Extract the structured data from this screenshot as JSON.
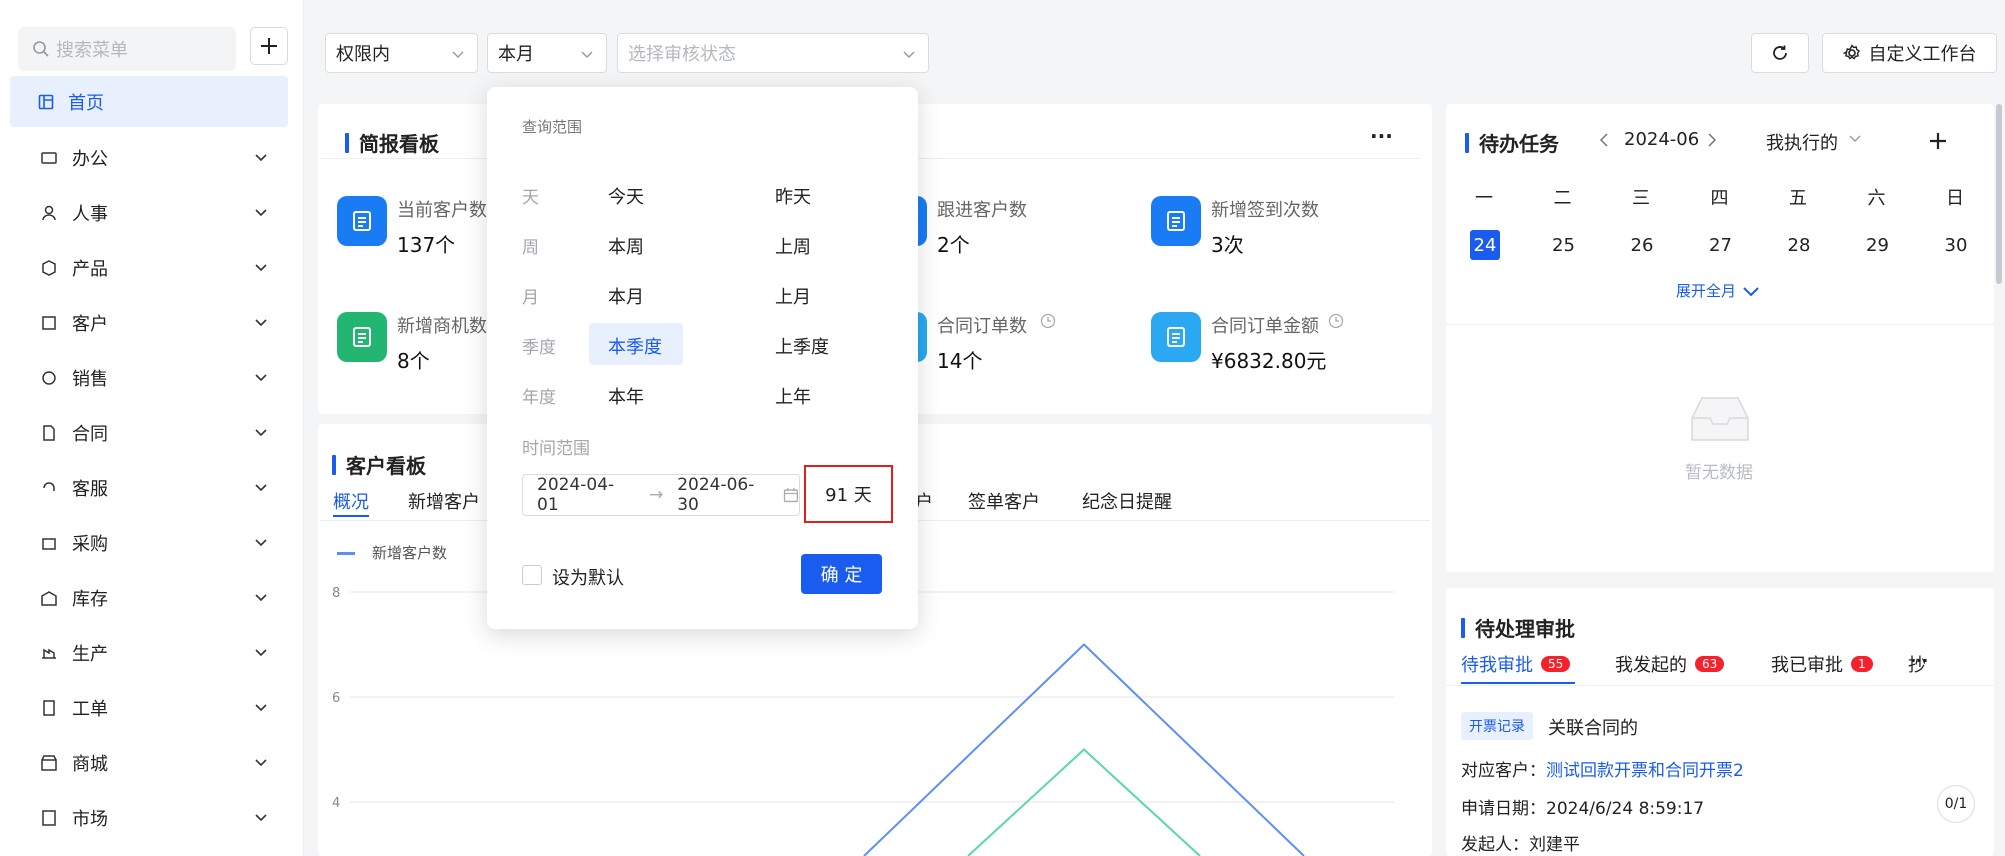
{
  "sidebar": {
    "search_placeholder": "搜索菜单",
    "home": "首页",
    "items": [
      "办公",
      "人事",
      "产品",
      "客户",
      "销售",
      "合同",
      "客服",
      "采购",
      "库存",
      "生产",
      "工单",
      "商城",
      "市场"
    ]
  },
  "filters": {
    "scope": "权限内",
    "period": "本月",
    "status_placeholder": "选择审核状态",
    "custom_btn": "自定义工作台"
  },
  "brief": {
    "title": "简报看板",
    "more": "···",
    "stats": [
      {
        "label": "当前客户数",
        "value": "137个",
        "color": "#1a7cf5"
      },
      {
        "label": "跟进客户数",
        "value": "2个",
        "color": "#1a7cf5"
      },
      {
        "label": "新增签到次数",
        "value": "3次",
        "color": "#1a7cf5"
      },
      {
        "label": "新增商机数",
        "value": "8个",
        "color": "#23b673"
      },
      {
        "label": "合同订单数",
        "value": "14个",
        "color": "#2aa8f2"
      },
      {
        "label": "合同订单金额",
        "value": "¥6832.80元",
        "color": "#2aa8f2"
      }
    ]
  },
  "customer": {
    "title": "客户看板",
    "tabs": [
      "概况",
      "新增客户",
      "签单客户",
      "纪念日提醒"
    ],
    "partial_tab": "户",
    "legend": "新增客户数",
    "chart_data": {
      "type": "line",
      "series": [
        {
          "name": "新增客户数",
          "color": "#5b8ff9"
        },
        {
          "name": "",
          "color": "#5ad8a6"
        }
      ],
      "y_ticks": [
        "8",
        "6",
        "4"
      ],
      "ylim": [
        0,
        8
      ],
      "peaks": [
        7,
        5
      ]
    }
  },
  "popup": {
    "header": "查询范围",
    "rows": [
      {
        "label": "天",
        "a": "今天",
        "b": "昨天"
      },
      {
        "label": "周",
        "a": "本周",
        "b": "上周"
      },
      {
        "label": "月",
        "a": "本月",
        "b": "上月"
      },
      {
        "label": "季度",
        "a": "本季度",
        "b": "上季度"
      },
      {
        "label": "年度",
        "a": "本年",
        "b": "上年"
      }
    ],
    "range_label": "时间范围",
    "start": "2024-04-01",
    "end": "2024-06-30",
    "arrow": "→",
    "days": "91 天",
    "default_label": "设为默认",
    "confirm": "确 定"
  },
  "todo": {
    "title": "待办任务",
    "month": "2024-06",
    "mine": "我执行的",
    "weekdays": [
      "一",
      "二",
      "三",
      "四",
      "五",
      "六",
      "日"
    ],
    "dates": [
      "24",
      "25",
      "26",
      "27",
      "28",
      "29",
      "30"
    ],
    "expand": "展开全月",
    "empty": "暂无数据"
  },
  "approval": {
    "title": "待处理审批",
    "tabs": [
      {
        "label": "待我审批",
        "badge": "55"
      },
      {
        "label": "我发起的",
        "badge": "63"
      },
      {
        "label": "我已审批",
        "badge": "1"
      }
    ],
    "partial_tab": "抄",
    "more": "···",
    "tag": "开票记录",
    "subject": "关联合同的",
    "customer_label": "对应客户：",
    "customer_value": "测试回款开票和合同开票2",
    "date_label": "申请日期：",
    "date_value": "2024/6/24 8:59:17",
    "initiator_label": "发起人：",
    "initiator_value": "刘建平",
    "pager": "0/1"
  }
}
